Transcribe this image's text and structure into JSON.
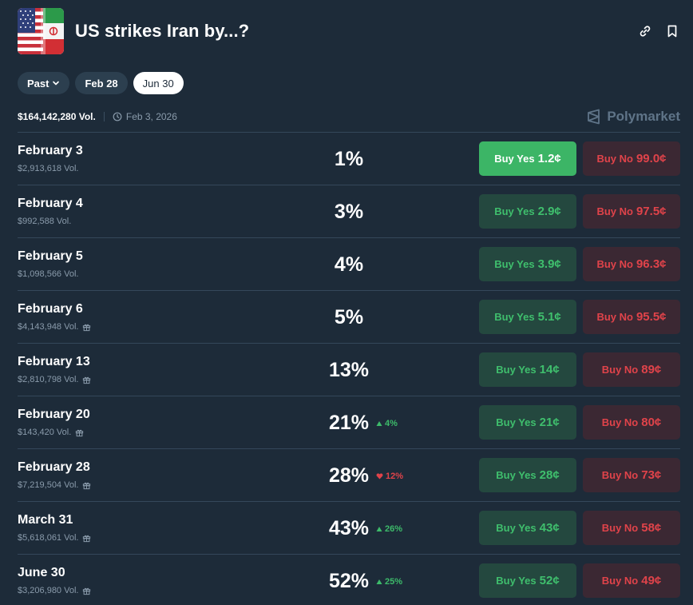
{
  "header": {
    "title": "US strikes Iran by...?",
    "icons": [
      "link-icon",
      "bookmark-icon"
    ]
  },
  "filters": {
    "past_label": "Past",
    "items": [
      "Feb 28",
      "Jun 30"
    ],
    "active": "Jun 30"
  },
  "stats": {
    "volume": "$164,142,280 Vol.",
    "end_date": "Feb 3, 2026"
  },
  "brand": "Polymarket",
  "colors": {
    "background": "#1d2b39",
    "yes_green": "#3cb566",
    "no_red": "#e0434a",
    "up_green": "#3dbb6a"
  },
  "rows": [
    {
      "name": "February 3",
      "vol": "$2,913,618 Vol.",
      "gift": false,
      "pct": "1%",
      "change": "",
      "change_dir": "",
      "yes_label": "Buy Yes",
      "yes_price": "1.2¢",
      "no_label": "Buy No",
      "no_price": "99.0¢",
      "yes_highlight": true
    },
    {
      "name": "February 4",
      "vol": "$992,588 Vol.",
      "gift": false,
      "pct": "3%",
      "change": "",
      "change_dir": "",
      "yes_label": "Buy Yes",
      "yes_price": "2.9¢",
      "no_label": "Buy No",
      "no_price": "97.5¢",
      "yes_highlight": false
    },
    {
      "name": "February 5",
      "vol": "$1,098,566 Vol.",
      "gift": false,
      "pct": "4%",
      "change": "",
      "change_dir": "",
      "yes_label": "Buy Yes",
      "yes_price": "3.9¢",
      "no_label": "Buy No",
      "no_price": "96.3¢",
      "yes_highlight": false
    },
    {
      "name": "February 6",
      "vol": "$4,143,948 Vol.",
      "gift": true,
      "pct": "5%",
      "change": "",
      "change_dir": "",
      "yes_label": "Buy Yes",
      "yes_price": "5.1¢",
      "no_label": "Buy No",
      "no_price": "95.5¢",
      "yes_highlight": false
    },
    {
      "name": "February 13",
      "vol": "$2,810,798 Vol.",
      "gift": true,
      "pct": "13%",
      "change": "",
      "change_dir": "",
      "yes_label": "Buy Yes",
      "yes_price": "14¢",
      "no_label": "Buy No",
      "no_price": "89¢",
      "yes_highlight": false
    },
    {
      "name": "February 20",
      "vol": "$143,420 Vol.",
      "gift": true,
      "pct": "21%",
      "change": "4%",
      "change_dir": "up",
      "yes_label": "Buy Yes",
      "yes_price": "21¢",
      "no_label": "Buy No",
      "no_price": "80¢",
      "yes_highlight": false
    },
    {
      "name": "February 28",
      "vol": "$7,219,504 Vol.",
      "gift": true,
      "pct": "28%",
      "change": "12%",
      "change_dir": "down",
      "yes_label": "Buy Yes",
      "yes_price": "28¢",
      "no_label": "Buy No",
      "no_price": "73¢",
      "yes_highlight": false
    },
    {
      "name": "March 31",
      "vol": "$5,618,061 Vol.",
      "gift": true,
      "pct": "43%",
      "change": "26%",
      "change_dir": "up",
      "yes_label": "Buy Yes",
      "yes_price": "43¢",
      "no_label": "Buy No",
      "no_price": "58¢",
      "yes_highlight": false
    },
    {
      "name": "June 30",
      "vol": "$3,206,980 Vol.",
      "gift": true,
      "pct": "52%",
      "change": "25%",
      "change_dir": "up",
      "yes_label": "Buy Yes",
      "yes_price": "52¢",
      "no_label": "Buy No",
      "no_price": "49¢",
      "yes_highlight": false
    }
  ]
}
